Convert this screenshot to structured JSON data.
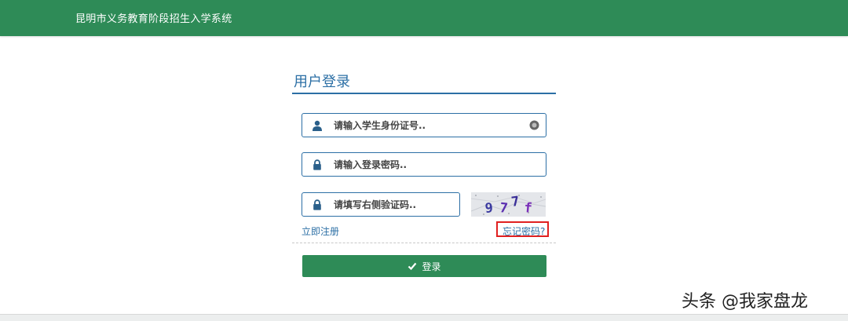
{
  "header": {
    "title": "昆明市义务教育阶段招生入学系统"
  },
  "login": {
    "title": "用户登录",
    "id_field": {
      "placeholder": "请输入学生身份证号.."
    },
    "password_field": {
      "placeholder": "请输入登录密码.."
    },
    "captcha_field": {
      "placeholder": "请填写右侧验证码.."
    },
    "captcha_text": "97 7f",
    "register_link": "立即注册",
    "forgot_link": "忘记密码?",
    "submit_label": "登录"
  },
  "watermark": "头条 @我家盘龙",
  "icons": {
    "id_field": "user-icon",
    "password_field": "lock-icon",
    "captcha_field": "lock-icon",
    "clear": "clear-circle-icon",
    "submit": "check-icon"
  },
  "colors": {
    "brand_green": "#2e8b57",
    "accent_blue": "#2c6fa5",
    "highlight_red": "#e02020"
  }
}
